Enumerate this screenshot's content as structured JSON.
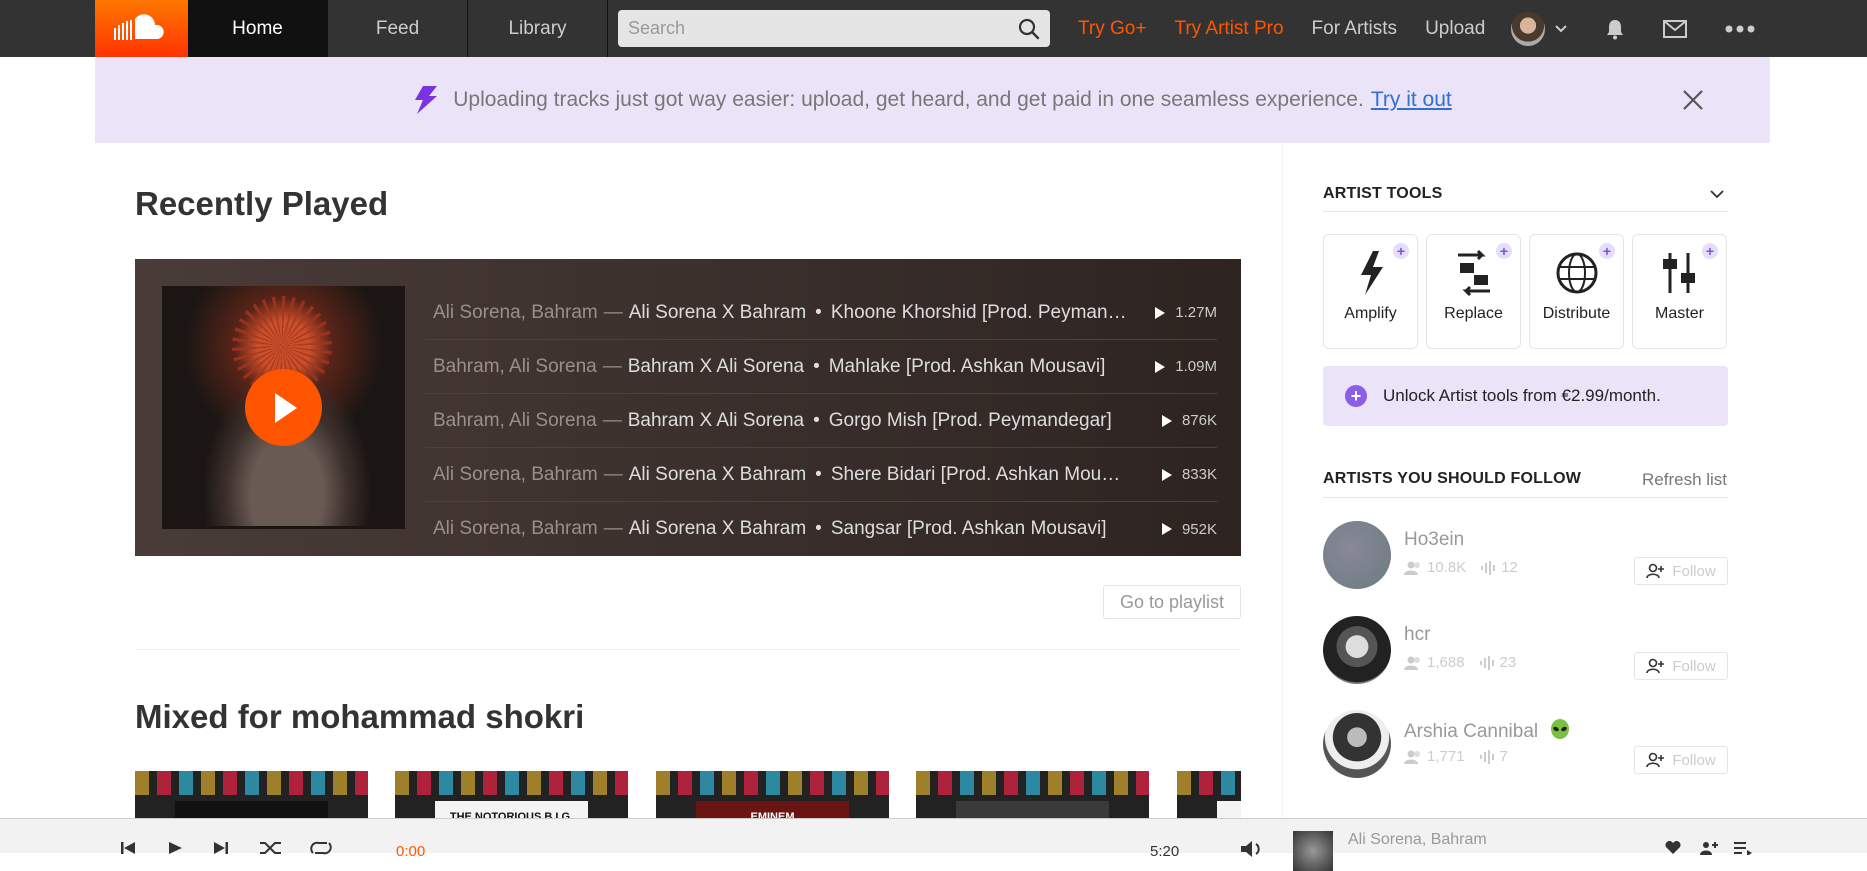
{
  "nav": {
    "tabs": [
      {
        "label": "Home"
      },
      {
        "label": "Feed"
      },
      {
        "label": "Library"
      }
    ],
    "search_placeholder": "Search",
    "links": {
      "try_go": "Try Go+",
      "try_artist_pro": "Try Artist Pro",
      "for_artists": "For Artists",
      "upload": "Upload"
    }
  },
  "banner": {
    "text": "Uploading tracks just got way easier: upload, get heard, and get paid in one seamless experience.",
    "link": "Try it out"
  },
  "recently_played": {
    "heading": "Recently Played",
    "tracks": [
      {
        "artist": "Ali Sorena, Bahram",
        "owner": "Ali Sorena X Bahram",
        "title": "Khoone Khorshid [Prod. Peymandegar]",
        "plays": "1.27M"
      },
      {
        "artist": "Bahram, Ali Sorena",
        "owner": "Bahram X Ali Sorena",
        "title": "Mahlake [Prod. Ashkan Mousavi]",
        "plays": "1.09M"
      },
      {
        "artist": "Bahram, Ali Sorena",
        "owner": "Bahram X Ali Sorena",
        "title": "Gorgo Mish [Prod. Peymandegar]",
        "plays": "876K"
      },
      {
        "artist": "Ali Sorena, Bahram",
        "owner": "Ali Sorena X Bahram",
        "title": "Shere Bidari [Prod. Ashkan Mousavi]",
        "plays": "833K"
      },
      {
        "artist": "Ali Sorena, Bahram",
        "owner": "Ali Sorena X Bahram",
        "title": "Sangsar [Prod. Ashkan Mousavi]",
        "plays": "952K"
      }
    ],
    "separator": "—",
    "go_to_playlist": "Go to playlist"
  },
  "mixed": {
    "heading": "Mixed for mohammad shokri",
    "cards": [
      {
        "label": ""
      },
      {
        "label": "THE NOTORIOUS B.I.G."
      },
      {
        "label": "EMINEM"
      },
      {
        "label": ""
      },
      {
        "label": ""
      }
    ]
  },
  "sidebar": {
    "artist_tools_heading": "ARTIST TOOLS",
    "tools": [
      {
        "label": "Amplify",
        "icon": "amplify-icon"
      },
      {
        "label": "Replace",
        "icon": "replace-icon"
      },
      {
        "label": "Distribute",
        "icon": "distribute-icon"
      },
      {
        "label": "Master",
        "icon": "master-icon"
      }
    ],
    "unlock_text": "Unlock Artist tools from €2.99/month.",
    "follow_heading": "ARTISTS YOU SHOULD FOLLOW",
    "refresh": "Refresh list",
    "artists": [
      {
        "name": "Ho3ein",
        "followers": "10.8K",
        "tracks": "12",
        "follow": "Follow"
      },
      {
        "name": "hcr",
        "followers": "1,688",
        "tracks": "23",
        "follow": "Follow"
      },
      {
        "name": "Arshia Cannibal",
        "followers": "1,771",
        "tracks": "7",
        "follow": "Follow"
      }
    ]
  },
  "player": {
    "elapsed": "0:00",
    "duration": "5:20",
    "artist": "Ali Sorena, Bahram"
  },
  "colors": {
    "accent": "#ff5500",
    "topbar": "#333333",
    "banner": "#ebe4f8",
    "link": "#2f6fd6"
  }
}
